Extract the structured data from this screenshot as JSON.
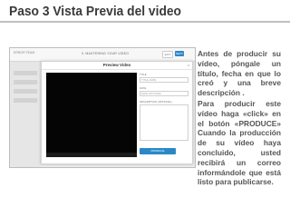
{
  "slide": {
    "title": "Paso  3 Vista Previa del video"
  },
  "app": {
    "topbar_label": "ERROR TEAM",
    "step_title": "3. MASTERING YOUR VIDEO",
    "exit_label": "EXIT",
    "next_label": "NEXT",
    "modal": {
      "title": "Preview Video",
      "close_label": "x",
      "fields": [
        {
          "label": "TITLE",
          "value": "TITLE, DATE"
        },
        {
          "label": "DATE",
          "value": "DATE OPTIONAL"
        },
        {
          "label": "DESCRIPTION (OPTIONAL)",
          "value": ""
        }
      ],
      "produce_label": "PRODUCE"
    }
  },
  "description": {
    "paragraph1": "Antes de producir su vídeo, póngale un título, fecha en que lo creó y una breve descripción .",
    "paragraph2": "Para producir este vídeo haga «click» en el botón «PRODUCE» Cuando la producción de su vídeo haya concluido, usted recibirá un correo informándole que está listo para publicarse."
  }
}
